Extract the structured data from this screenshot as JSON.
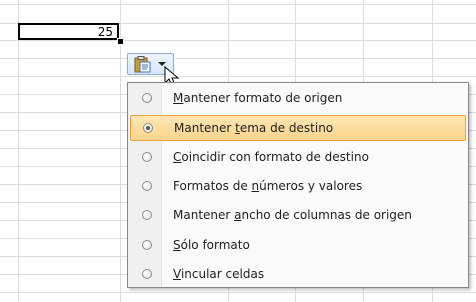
{
  "sheet": {
    "active_cell_value": "25"
  },
  "paste_options_button": {
    "icon": "clipboard-paste-icon",
    "arrow_icon": "dropdown-arrow-icon"
  },
  "menu": {
    "items": [
      {
        "pre": "",
        "key": "M",
        "post": "antener formato de origen",
        "selected": false
      },
      {
        "pre": "Mantener ",
        "key": "t",
        "post": "ema de destino",
        "selected": true
      },
      {
        "pre": "",
        "key": "C",
        "post": "oincidir con formato de destino",
        "selected": false
      },
      {
        "pre": "Formatos de ",
        "key": "n",
        "post": "úmeros y valores",
        "selected": false
      },
      {
        "pre": "Mantener ",
        "key": "a",
        "post": "ncho de columnas de origen",
        "selected": false
      },
      {
        "pre": "",
        "key": "S",
        "post": "ólo formato",
        "selected": false
      },
      {
        "pre": "",
        "key": "V",
        "post": "incular celdas",
        "selected": false
      }
    ]
  }
}
